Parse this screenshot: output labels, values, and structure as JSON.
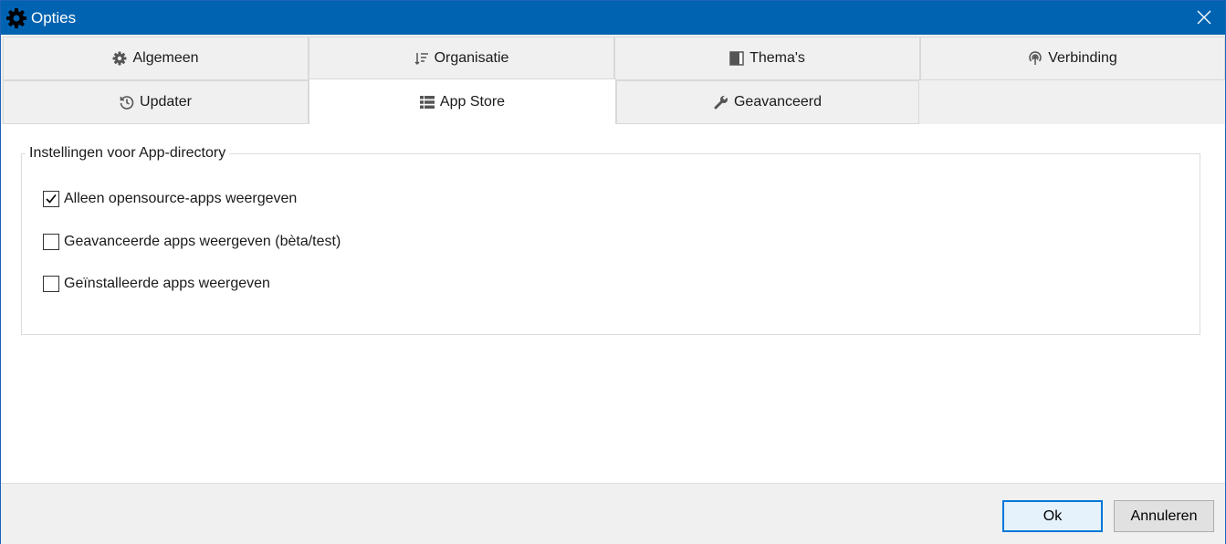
{
  "window": {
    "title": "Opties",
    "title_icon": "gear-icon",
    "close_icon": "close-icon"
  },
  "tabs": {
    "row1": [
      {
        "label": "Algemeen",
        "icon": "gear-icon"
      },
      {
        "label": "Organisatie",
        "icon": "sort-icon"
      },
      {
        "label": "Thema's",
        "icon": "theme-icon"
      },
      {
        "label": "Verbinding",
        "icon": "broadcast-icon"
      }
    ],
    "row2": [
      {
        "label": "Updater",
        "icon": "history-icon"
      },
      {
        "label": "App Store",
        "icon": "list-icon"
      },
      {
        "label": "Geavanceerd",
        "icon": "wrench-icon"
      }
    ],
    "active": "App Store"
  },
  "app_directory": {
    "legend": "Instellingen voor App-directory",
    "checkboxes": [
      {
        "label": "Alleen opensource-apps weergeven",
        "checked": true
      },
      {
        "label": "Geavanceerde apps weergeven (bèta/test)",
        "checked": false
      },
      {
        "label": "Geïnstalleerde apps weergeven",
        "checked": false
      }
    ]
  },
  "buttons": {
    "ok": "Ok",
    "cancel": "Annuleren"
  },
  "colors": {
    "titlebar": "#0063b1",
    "accent": "#0078d7"
  }
}
